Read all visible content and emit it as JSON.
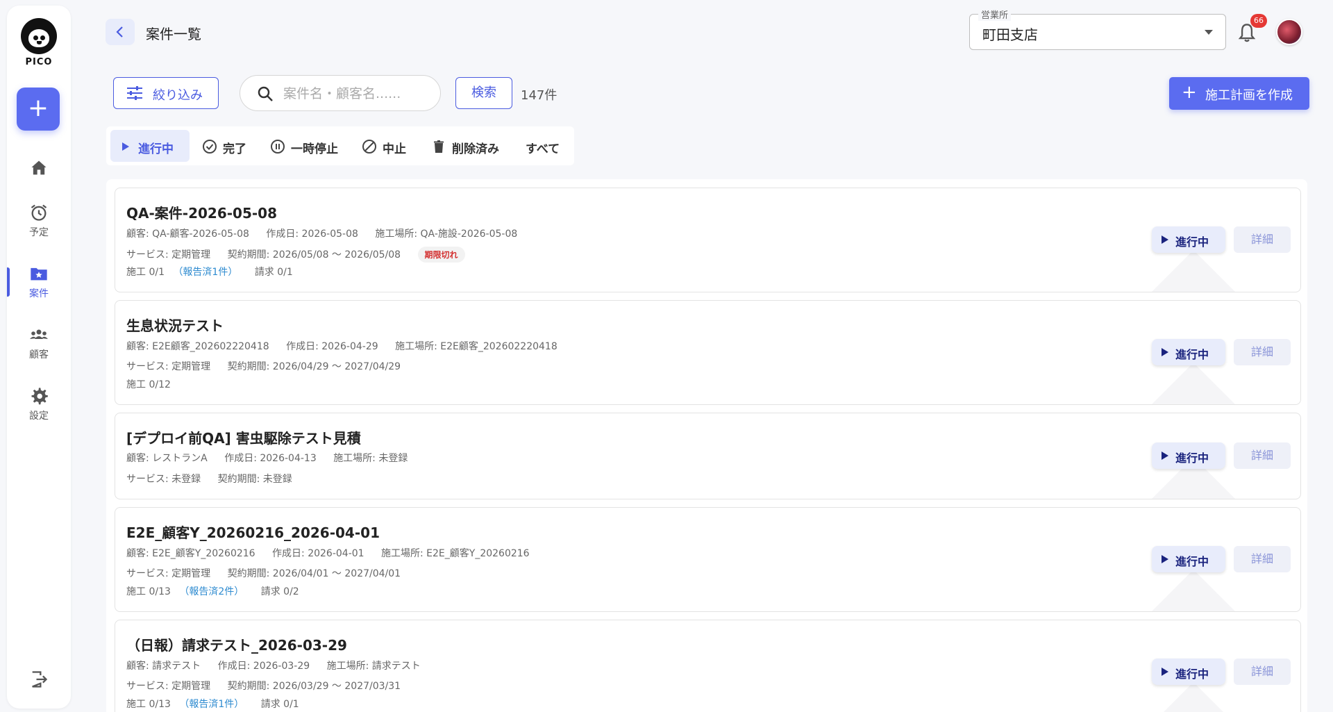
{
  "app": {
    "logo_text": "PICO"
  },
  "sidebar": {
    "add_label": "+",
    "items": [
      {
        "label": "",
        "icon": "home-icon"
      },
      {
        "label": "予定",
        "icon": "alarm-clock-icon"
      },
      {
        "label": "案件",
        "icon": "folder-star-icon",
        "active": true
      },
      {
        "label": "顧客",
        "icon": "people-icon"
      },
      {
        "label": "設定",
        "icon": "gear-icon"
      }
    ]
  },
  "header": {
    "title": "案件一覧",
    "office_label": "営業所",
    "office_value": "町田支店",
    "notification_count": "66"
  },
  "toolbar": {
    "filter_label": "絞り込み",
    "search_placeholder": "案件名・顧客名......",
    "search_button": "検索",
    "count": "147件",
    "create_label": "施工計画を作成"
  },
  "tabs": [
    {
      "label": "進行中",
      "icon": "play-icon",
      "active": true
    },
    {
      "label": "完了",
      "icon": "check-circle-icon"
    },
    {
      "label": "一時停止",
      "icon": "pause-circle-icon"
    },
    {
      "label": "中止",
      "icon": "block-icon"
    },
    {
      "label": "削除済み",
      "icon": "trash-icon"
    },
    {
      "label": "すべて",
      "icon": ""
    }
  ],
  "projects": [
    {
      "title": "QA-案件-2026-05-08",
      "customer": "顧客: QA-顧客-2026-05-08",
      "created": "作成日: 2026-05-08",
      "site": "施工場所: QA-施設-2026-05-08",
      "service": "サービス: 定期管理",
      "contract": "契約期間: 2026/05/08 〜 2026/05/08",
      "badge": "期限切れ",
      "work": "施工 0/1",
      "report": "（報告済1件）",
      "billing": "請求 0/1",
      "status": "進行中",
      "detail": "詳細"
    },
    {
      "title": "生息状況テスト",
      "customer": "顧客: E2E顧客_202602220418",
      "created": "作成日: 2026-04-29",
      "site": "施工場所: E2E顧客_202602220418",
      "service": "サービス: 定期管理",
      "contract": "契約期間: 2026/04/29 〜 2027/04/29",
      "work": "施工 0/12",
      "status": "進行中",
      "detail": "詳細"
    },
    {
      "title": "[デプロイ前QA] 害虫駆除テスト見積",
      "customer": "顧客: レストランA",
      "created": "作成日: 2026-04-13",
      "site": "施工場所: 未登録",
      "service": "サービス: 未登録",
      "contract": "契約期間: 未登録",
      "status": "進行中",
      "detail": "詳細"
    },
    {
      "title": "E2E_顧客Y_20260216_2026-04-01",
      "customer": "顧客: E2E_顧客Y_20260216",
      "created": "作成日: 2026-04-01",
      "site": "施工場所: E2E_顧客Y_20260216",
      "service": "サービス: 定期管理",
      "contract": "契約期間: 2026/04/01 〜 2027/04/01",
      "work": "施工 0/13",
      "report": "（報告済2件）",
      "billing": "請求 0/2",
      "status": "進行中",
      "detail": "詳細"
    },
    {
      "title": "（日報）請求テスト_2026-03-29",
      "customer": "顧客: 請求テスト",
      "created": "作成日: 2026-03-29",
      "site": "施工場所: 請求テスト",
      "service": "サービス: 定期管理",
      "contract": "契約期間: 2026/03/29 〜 2027/03/31",
      "work": "施工 0/13",
      "report": "（報告済1件）",
      "billing": "請求 0/1",
      "status": "進行中",
      "detail": "詳細"
    }
  ],
  "colors": {
    "accent": "#5b6cf0",
    "link": "#2e8bd0",
    "danger": "#d32f2f"
  }
}
